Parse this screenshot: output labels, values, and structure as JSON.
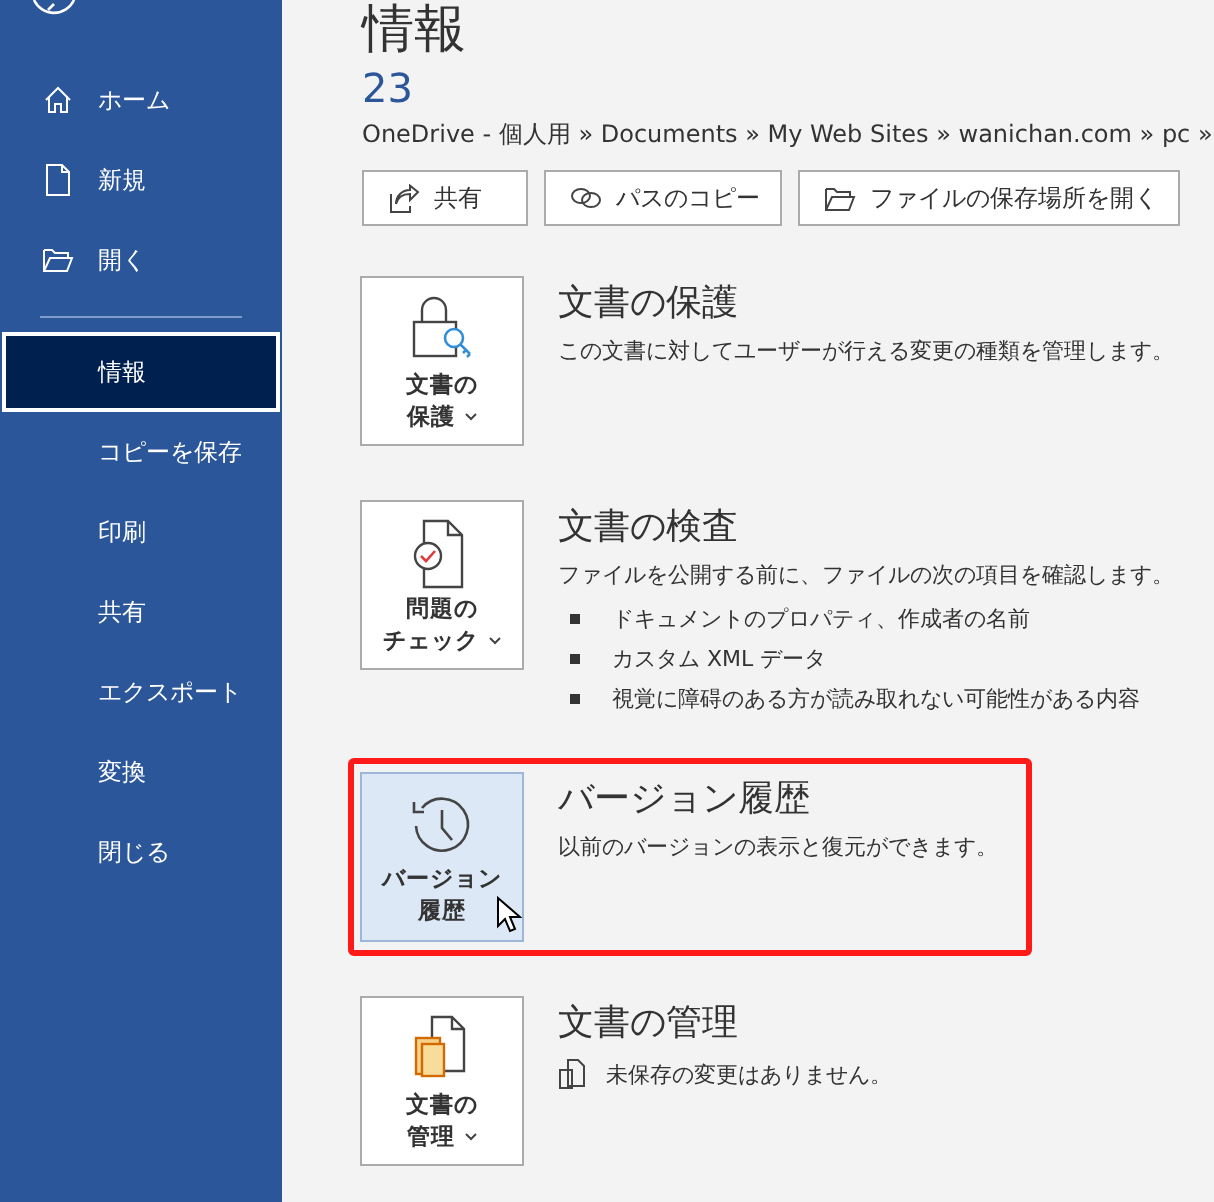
{
  "sidebar": {
    "items": [
      {
        "label": "ホーム",
        "selected": false
      },
      {
        "label": "新規",
        "selected": false
      },
      {
        "label": "開く",
        "selected": false
      },
      {
        "label": "情報",
        "selected": true
      },
      {
        "label": "コピーを保存",
        "selected": false
      },
      {
        "label": "印刷",
        "selected": false
      },
      {
        "label": "共有",
        "selected": false
      },
      {
        "label": "エクスポート",
        "selected": false
      },
      {
        "label": "変換",
        "selected": false
      },
      {
        "label": "閉じる",
        "selected": false
      }
    ]
  },
  "page_title": "情報",
  "document_name": "23",
  "path": "OneDrive - 個人用 » Documents » My Web Sites » wanichan.com » pc »",
  "actions": [
    {
      "label": "共有"
    },
    {
      "label": "パスのコピー"
    },
    {
      "label": "ファイルの保存場所を開く"
    }
  ],
  "sections": [
    {
      "button_lines": [
        "文書の",
        "保護"
      ],
      "has_menu": true,
      "highlighted": false,
      "title": "文書の保護",
      "description": "この文書に対してユーザーが行える変更の種類を管理します。"
    },
    {
      "button_lines": [
        "問題の",
        "チェック"
      ],
      "has_menu": true,
      "highlighted": false,
      "title": "文書の検査",
      "description": "ファイルを公開する前に、ファイルの次の項目を確認します。",
      "bullets": [
        "ドキュメントのプロパティ、作成者の名前",
        "カスタム XML データ",
        "視覚に障碍のある方が読み取れない可能性がある内容"
      ]
    },
    {
      "button_lines": [
        "バージョン",
        "履歴"
      ],
      "has_menu": false,
      "highlighted": true,
      "title": "バージョン履歴",
      "description": "以前のバージョンの表示と復元ができます。"
    },
    {
      "button_lines": [
        "文書の",
        "管理"
      ],
      "has_menu": true,
      "highlighted": false,
      "title": "文書の管理",
      "status": "未保存の変更はありません。"
    }
  ]
}
